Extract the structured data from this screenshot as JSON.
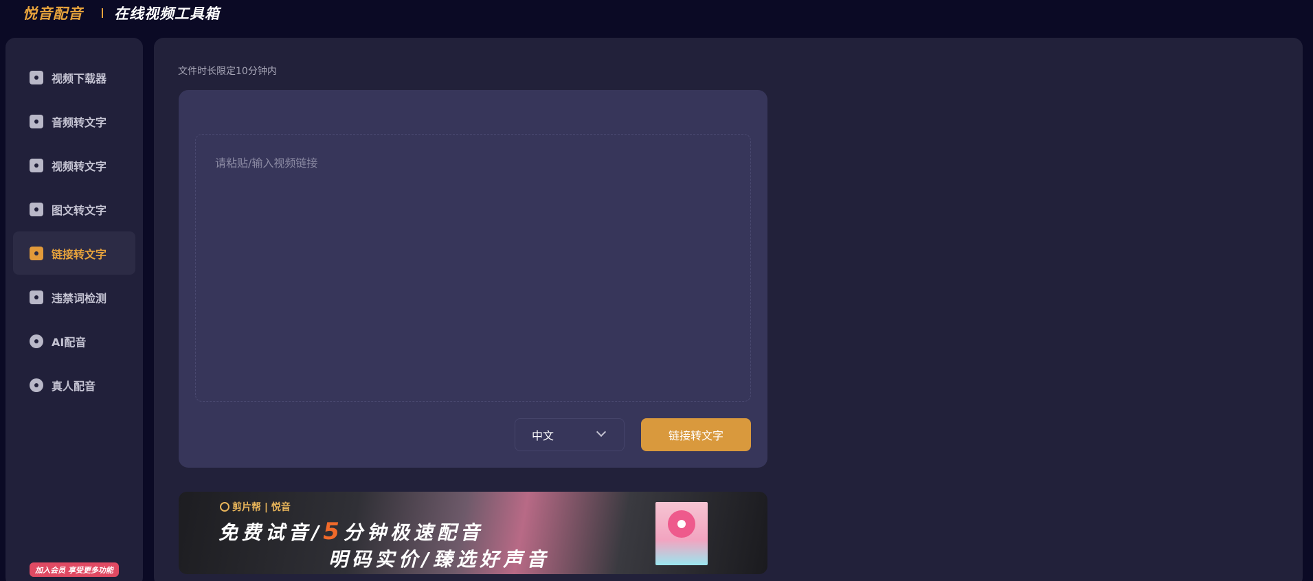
{
  "header": {
    "brand": "悦音配音",
    "subtitle": "在线视频工具箱"
  },
  "sidebar": {
    "items": [
      {
        "label": "视频下载器",
        "icon": "download-icon",
        "active": false
      },
      {
        "label": "音频转文字",
        "icon": "audio-file-icon",
        "active": false
      },
      {
        "label": "视频转文字",
        "icon": "video-icon",
        "active": false
      },
      {
        "label": "图文转文字",
        "icon": "image-text-icon",
        "active": false
      },
      {
        "label": "链接转文字",
        "icon": "link-icon",
        "active": true
      },
      {
        "label": "违禁词检测",
        "icon": "detect-icon",
        "active": false
      },
      {
        "label": "AI配音",
        "icon": "ai-dub-icon",
        "active": false
      },
      {
        "label": "真人配音",
        "icon": "headset-icon",
        "active": false
      }
    ],
    "vip_badge": "加入会员 享受更多功能"
  },
  "main": {
    "hint": "文件时长限定10分钟内",
    "input": {
      "placeholder": "请粘贴/输入视频链接",
      "value": ""
    },
    "language": {
      "selected": "中文"
    },
    "submit_label": "链接转文字"
  },
  "banner": {
    "logo_text": "剪片帮 | 悦音",
    "line1_part1": "免费试音/",
    "line1_highlight": "5",
    "line1_part2": "分钟极速配音",
    "line2": "明码实价/臻选好声音"
  },
  "colors": {
    "background": "#0b0a25",
    "accent": "#d9993d",
    "brand": "#e7a33c",
    "card": "#37365a",
    "vip": "#e04a63"
  }
}
